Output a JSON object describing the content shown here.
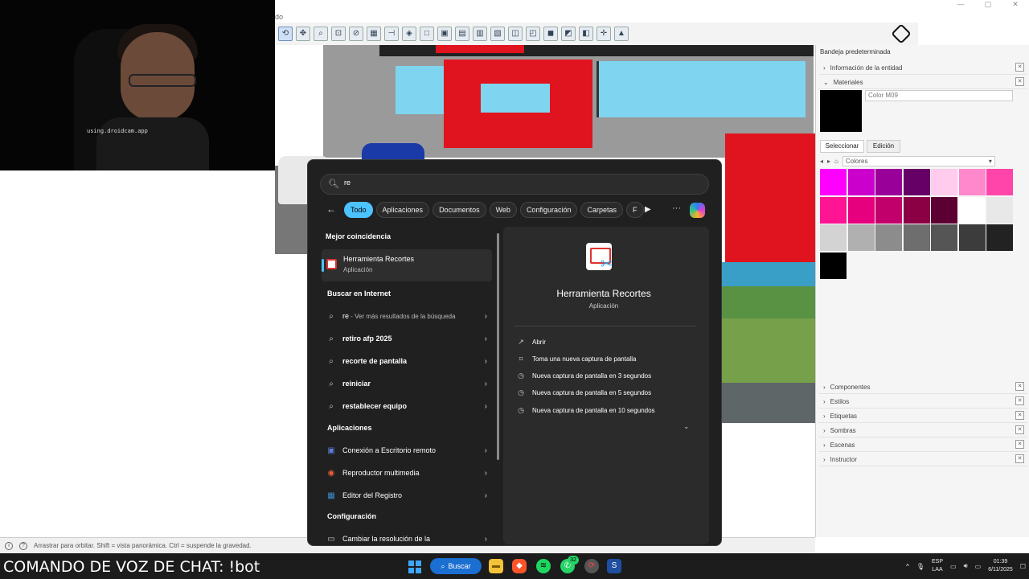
{
  "webcam": {
    "caption": "using.droidcam.app"
  },
  "window": {
    "title_fragment": "do",
    "controls": [
      "—",
      "▢",
      "✕"
    ]
  },
  "toolbar": {
    "icons": [
      "orbit-icon",
      "pan-icon",
      "zoom-icon",
      "zoom-extents-icon",
      "section-icon",
      "paint-icon",
      "tape-icon",
      "view-iso-icon",
      "view-top-icon",
      "view-front-icon",
      "view-right-icon",
      "view-back-icon",
      "view-left-icon",
      "xray-icon",
      "wireframe-icon",
      "shaded-icon",
      "textured-icon",
      "mono-icon",
      "axes-icon",
      "sandbox-icon"
    ]
  },
  "statusbar": {
    "hint": "Arrastrar para orbitar. Shift = vista panorámica. Ctrl = suspende la gravedad."
  },
  "tray": {
    "title": "Bandeja predeterminada",
    "entity_info": "Información de la entidad",
    "materials": "Materiales",
    "material_name": "Color M09",
    "tab_select": "Seleccionar",
    "tab_edit": "Edición",
    "collection": "Colores",
    "swatch_colors": [
      "#ff00ff",
      "#cc00cc",
      "#990099",
      "#660066",
      "#ffccee",
      "#ff88cc",
      "#ff44aa",
      "#ff1493",
      "#e6007e",
      "#c2006b",
      "#8b0045",
      "#5c0033",
      "#ffffff",
      "#e8e8e8",
      "#d3d3d3",
      "#b0b0b0",
      "#8c8c8c",
      "#6e6e6e",
      "#555555",
      "#3c3c3c",
      "#222222",
      "#000000"
    ],
    "sections": [
      "Componentes",
      "Estilos",
      "Etiquetas",
      "Sombras",
      "Escenas",
      "Instructor"
    ]
  },
  "start": {
    "search_value": "re",
    "filters": [
      "Todo",
      "Aplicaciones",
      "Documentos",
      "Web",
      "Configuración",
      "Carpetas",
      "F"
    ],
    "best_match_header": "Mejor coincidencia",
    "best_match": {
      "name": "Herramienta Recortes",
      "type": "Aplicación"
    },
    "internet_header": "Buscar en Internet",
    "internet_first": {
      "query": "re",
      "suffix": " - Ver más resultados de la búsqueda"
    },
    "internet_items": [
      "retiro afp 2025",
      "recorte de pantalla",
      "reiniciar",
      "restablecer equipo"
    ],
    "apps_header": "Aplicaciones",
    "apps": [
      "Conexión a Escritorio remoto",
      "Reproductor multimedia",
      "Editor del Registro"
    ],
    "settings_header": "Configuración",
    "settings_item": "Cambiar la resolución de la",
    "preview": {
      "name": "Herramienta Recortes",
      "type": "Aplicación"
    },
    "actions": [
      "Abrir",
      "Toma una nueva captura de pantalla",
      "Nueva captura de pantalla en 3 segundos",
      "Nueva captura de pantalla en 5 segundos",
      "Nueva captura de pantalla en 10 segundos"
    ]
  },
  "taskbar": {
    "chat_command": "COMANDO DE VOZ DE CHAT: !bot",
    "search_label": "Buscar",
    "whatsapp_badge": "32",
    "lang_top": "ESP",
    "lang_bottom": "LAA",
    "time": "01:39",
    "date": "6/11/2025"
  }
}
